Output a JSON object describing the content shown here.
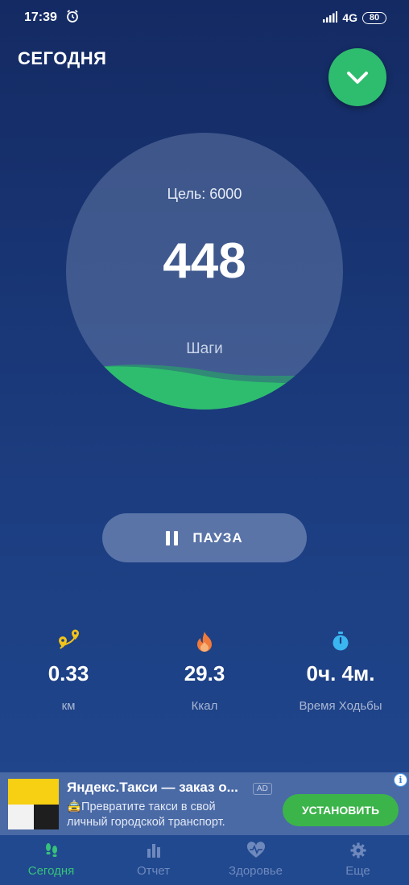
{
  "status_bar": {
    "time": "17:39",
    "network": "4G",
    "battery": "80"
  },
  "header": {
    "title": "СЕГОДНЯ"
  },
  "progress": {
    "goal_label": "Цель: 6000",
    "steps": "448",
    "steps_label": "Шаги",
    "fraction": 0.075
  },
  "controls": {
    "pause_label": "ПАУЗА"
  },
  "stats": [
    {
      "icon": "map-pin-route-icon",
      "value": "0.33",
      "label": "км"
    },
    {
      "icon": "flame-icon",
      "value": "29.3",
      "label": "Ккал"
    },
    {
      "icon": "stopwatch-icon",
      "value": "0ч. 4м.",
      "label": "Время Ходьбы"
    }
  ],
  "ad": {
    "title": "Яндекс.Такси — заказ о...",
    "badge": "AD",
    "description": "🚖Превратите такси в свой личный городской транспорт.",
    "install_label": "УСТАНОВИТЬ"
  },
  "bottom_nav": [
    {
      "icon": "footsteps-icon",
      "label": "Сегодня",
      "active": true
    },
    {
      "icon": "bar-chart-icon",
      "label": "Отчет",
      "active": false
    },
    {
      "icon": "heart-pulse-icon",
      "label": "Здоровье",
      "active": false
    },
    {
      "icon": "gear-icon",
      "label": "Еще",
      "active": false
    }
  ],
  "colors": {
    "accent_green": "#2ebd6e",
    "background_top": "#142a63",
    "background_bottom": "#21488f",
    "nav_active": "#36c27a",
    "nav_inactive": "#6f89bd"
  }
}
